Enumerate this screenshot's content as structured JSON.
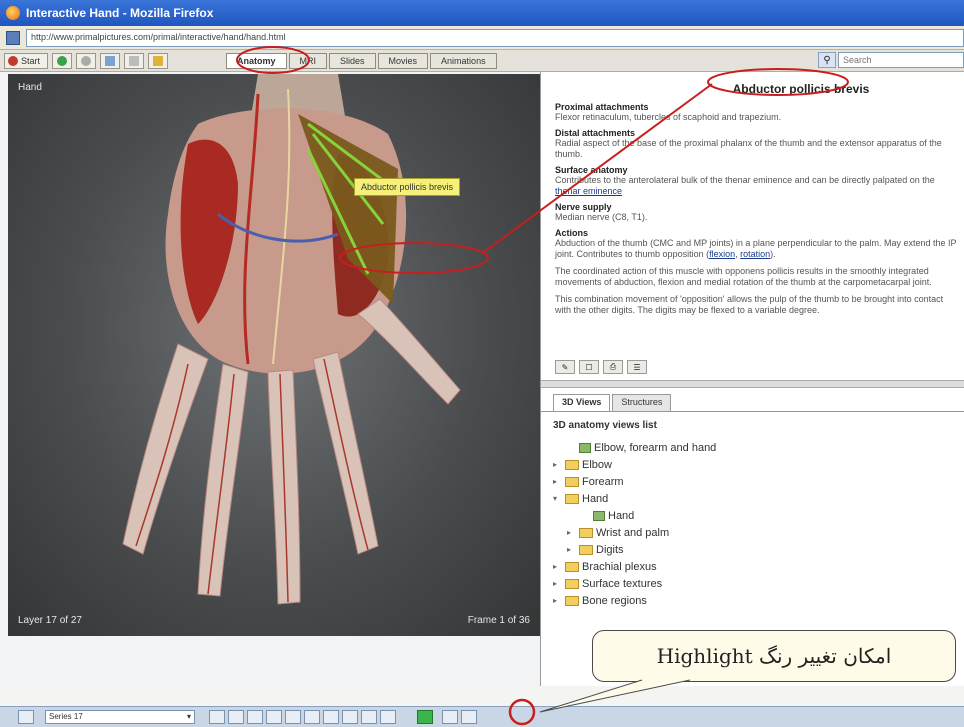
{
  "window": {
    "title": "Interactive Hand - Mozilla Firefox"
  },
  "address": {
    "url": "http://www.primalpictures.com/primal/interactive/hand/hand.html"
  },
  "toolbar": {
    "start_label": "Start",
    "tabs": [
      "Anatomy",
      "MRI",
      "Slides",
      "Movies",
      "Animations"
    ],
    "search_placeholder": "Search"
  },
  "viewer": {
    "region_label": "Hand",
    "layer_label": "Layer 17 of 27",
    "frame_label": "Frame 1 of 36",
    "highlight_tag": "Abductor pollicis brevis"
  },
  "info": {
    "title": "Abductor pollicis brevis",
    "sections": [
      {
        "heading": "Proximal attachments",
        "text": "Flexor retinaculum, tubercles of scaphoid and trapezium."
      },
      {
        "heading": "Distal attachments",
        "text": "Radial aspect of the base of the proximal phalanx of the thumb and the extensor apparatus of the thumb."
      },
      {
        "heading": "Surface anatomy",
        "text": "Contributes to the anterolateral bulk of the thenar eminence and can be directly palpated on the ",
        "link": "thenar eminence"
      },
      {
        "heading": "Nerve supply",
        "text": "Median nerve (C8, T1)."
      },
      {
        "heading": "Actions",
        "text": "Abduction of the thumb (CMC and MP joints) in a plane perpendicular to the palm. May extend the IP joint. Contributes to thumb opposition (",
        "link": "flexion",
        "text2": ", ",
        "link2": "rotation",
        "text3": ")."
      },
      {
        "heading": "",
        "text": "The coordinated action of this muscle with opponens pollicis results in the smoothly integrated movements of abduction, flexion and medial rotation of the thumb at the carpometacarpal joint."
      },
      {
        "heading": "",
        "text": "This combination movement of 'opposition' allows the pulp of the thumb to be brought into contact with the other digits. The digits may be flexed to a variable degree."
      }
    ]
  },
  "lower_panel": {
    "tabs": [
      "3D Views",
      "Structures"
    ],
    "tree_heading": "3D anatomy views list",
    "tree": [
      {
        "label": "Elbow, forearm and hand",
        "indent": 1,
        "type": "leaf",
        "arrow": ""
      },
      {
        "label": "Elbow",
        "indent": 0,
        "type": "folder",
        "arrow": "▸"
      },
      {
        "label": "Forearm",
        "indent": 0,
        "type": "folder",
        "arrow": "▸"
      },
      {
        "label": "Hand",
        "indent": 0,
        "type": "folder",
        "arrow": "▾"
      },
      {
        "label": "Hand",
        "indent": 2,
        "type": "leaf",
        "arrow": ""
      },
      {
        "label": "Wrist and palm",
        "indent": 1,
        "type": "folder",
        "arrow": "▸"
      },
      {
        "label": "Digits",
        "indent": 1,
        "type": "folder",
        "arrow": "▸"
      },
      {
        "label": "Brachial plexus",
        "indent": 0,
        "type": "folder",
        "arrow": "▸"
      },
      {
        "label": "Surface textures",
        "indent": 0,
        "type": "folder",
        "arrow": "▸"
      },
      {
        "label": "Bone regions",
        "indent": 0,
        "type": "folder",
        "arrow": "▸"
      }
    ]
  },
  "bottom": {
    "series_label": "Series 17"
  },
  "callout": {
    "text": "امکان تغییر رنگ Highlight"
  },
  "colors": {
    "annotation_red": "#c81e1e",
    "highlight_yellow": "#f4f07a",
    "titlebar_blue": "#2a63cc"
  }
}
